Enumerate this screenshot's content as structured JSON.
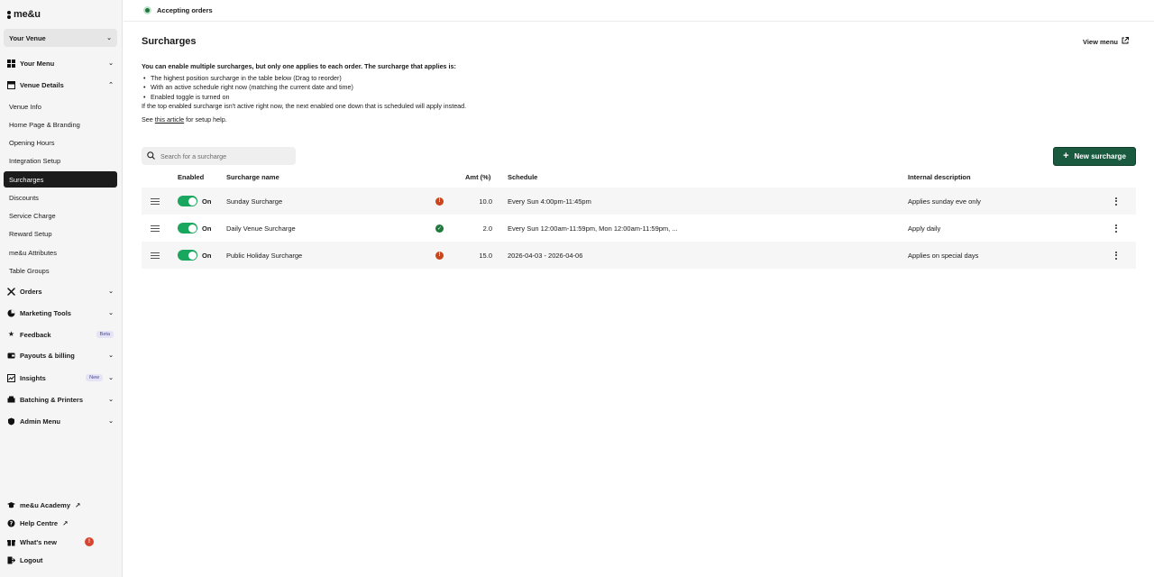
{
  "brand": {
    "logo_text": "me&u"
  },
  "venue_select": {
    "label": "Your Venue"
  },
  "sidebar": {
    "your_menu": "Your Menu",
    "venue_details": "Venue Details",
    "sub_items": [
      "Venue Info",
      "Home Page & Branding",
      "Opening Hours",
      "Integration Setup",
      "Surcharges",
      "Discounts",
      "Service Charge",
      "Reward Setup",
      "me&u Attributes",
      "Table Groups"
    ],
    "orders": "Orders",
    "marketing": "Marketing Tools",
    "feedback": "Feedback",
    "feedback_badge": "Beta",
    "payouts": "Payouts & billing",
    "insights": "Insights",
    "insights_badge": "New",
    "batching": "Batching & Printers",
    "admin": "Admin Menu",
    "academy": "me&u Academy",
    "help": "Help Centre",
    "whats_new": "What's new",
    "whats_new_count": "!",
    "logout": "Logout"
  },
  "topbar": {
    "status": "Accepting orders"
  },
  "page": {
    "title": "Surcharges",
    "view_menu": "View menu",
    "lead": "You can enable multiple surcharges, but only one applies to each order. The surcharge that applies is:",
    "bullets": [
      "The highest position surcharge in the table below (Drag to reorder)",
      "With an active schedule right now (matching the current date and time)",
      "Enabled toggle is turned on"
    ],
    "fallback": "If the top enabled surcharge isn't active right now, the next enabled one down that is scheduled will apply instead.",
    "see_prefix": "See",
    "see_link": "this article",
    "see_suffix": "for setup help.",
    "search_placeholder": "Search for a surcharge",
    "new_button": "New surcharge"
  },
  "table": {
    "headers": {
      "enabled": "Enabled",
      "name": "Surcharge name",
      "amt": "Amt (%)",
      "schedule": "Schedule",
      "desc": "Internal description"
    },
    "rows": [
      {
        "enabled": "On",
        "name": "Sunday Surcharge",
        "status": "warning",
        "amt": "10.0",
        "schedule": "Every Sun 4:00pm-11:45pm",
        "desc": "Applies sunday eve only"
      },
      {
        "enabled": "On",
        "name": "Daily Venue Surcharge",
        "status": "active",
        "amt": "2.0",
        "schedule": "Every Sun 12:00am-11:59pm, Mon 12:00am-11:59pm, ...",
        "desc": "Apply daily"
      },
      {
        "enabled": "On",
        "name": "Public Holiday Surcharge",
        "status": "warning",
        "amt": "15.0",
        "schedule": "2026-04-03 - 2026-04-06",
        "desc": "Applies on special days"
      }
    ]
  },
  "colors": {
    "accent": "#1a5b40",
    "toggle": "#19a65e",
    "warn": "#c9461f",
    "ok": "#207a3c"
  }
}
